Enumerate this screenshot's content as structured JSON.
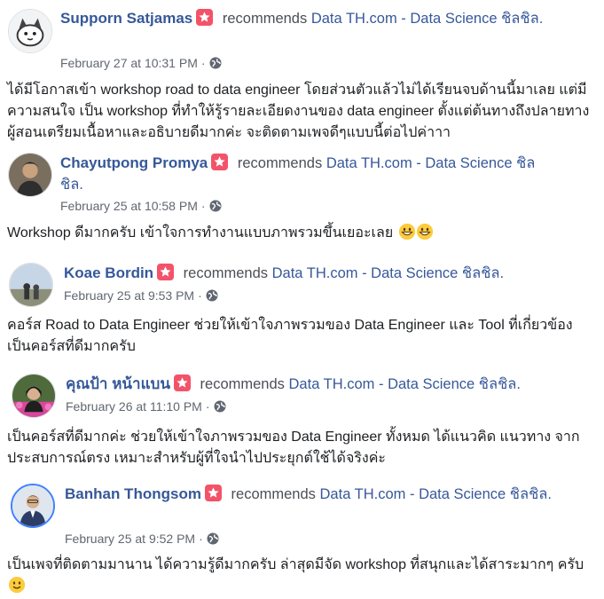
{
  "reviews": [
    {
      "name": "Supporn Satjamas",
      "recommends": "recommends",
      "page": "Data TH.com - Data Science ชิลชิล.",
      "time": "February 27 at 10:31 PM",
      "text": "ได้มีโอกาสเข้า workshop road to data engineer โดยส่วนตัวแล้วไม่ได้เรียนจบด้านนี้มาเลย แต่มีความสนใจ เป็น workshop ที่ทำให้รู้รายละเอียดงานของ data engineer ตั้งแต่ต้นทางถึงปลายทาง ผู้สอนเตรียมเนื้อหาและอธิบายดีมากค่ะ จะติดตามเพจดีๆแบบนี้ต่อไปค่าาา"
    },
    {
      "name": "Chayutpong Promya",
      "recommends": "recommends",
      "page": "Data TH.com - Data Science ชิลชิล.",
      "time": "February 25 at 10:58 PM",
      "text": "Workshop ดีมากครับ เข้าใจการทำงานแบบภาพรวมขึ้นเยอะเลย"
    },
    {
      "name": "Koae Bordin",
      "recommends": "recommends",
      "page": "Data TH.com - Data Science ชิลชิล.",
      "time": "February 25 at 9:53 PM",
      "text": "คอร์ส Road to Data Engineer ช่วยให้เข้าใจภาพรวมของ Data Engineer และ Tool ที่เกี่ยวข้อง เป็นคอร์สที่ดีมากครับ"
    },
    {
      "name": "คุณป้า หน้าแบน",
      "recommends": "recommends",
      "page": "Data TH.com - Data Science ชิลชิล.",
      "time": "February 26 at 11:10 PM",
      "text": "เป็นคอร์สที่ดีมากค่ะ ช่วยให้เข้าใจภาพรวมของ Data Engineer ทั้งหมด ได้แนวคิด แนวทาง จากประสบการณ์ตรง เหมาะสำหรับผู้ที่ใจนำไปประยุกต์ใช้ได้จริงค่ะ"
    },
    {
      "name": "Banhan Thongsom",
      "recommends": "recommends",
      "page": "Data TH.com - Data Science ชิลชิล.",
      "time": "February 25 at 9:52 PM",
      "text": "เป็นเพจที่ติดตามมานาน ได้ความรู้ดีมากครับ ล่าสุดมีจัด workshop ที่สนุกและได้สาระมากๆ ครับ"
    }
  ],
  "separator": "·",
  "colors": {
    "link": "#365899",
    "badge": "#f35369",
    "meta": "#606770"
  },
  "icons": {
    "badge": "recommend-star-icon",
    "privacy": "globe-icon",
    "emoji": "grinning-face-emoji"
  }
}
